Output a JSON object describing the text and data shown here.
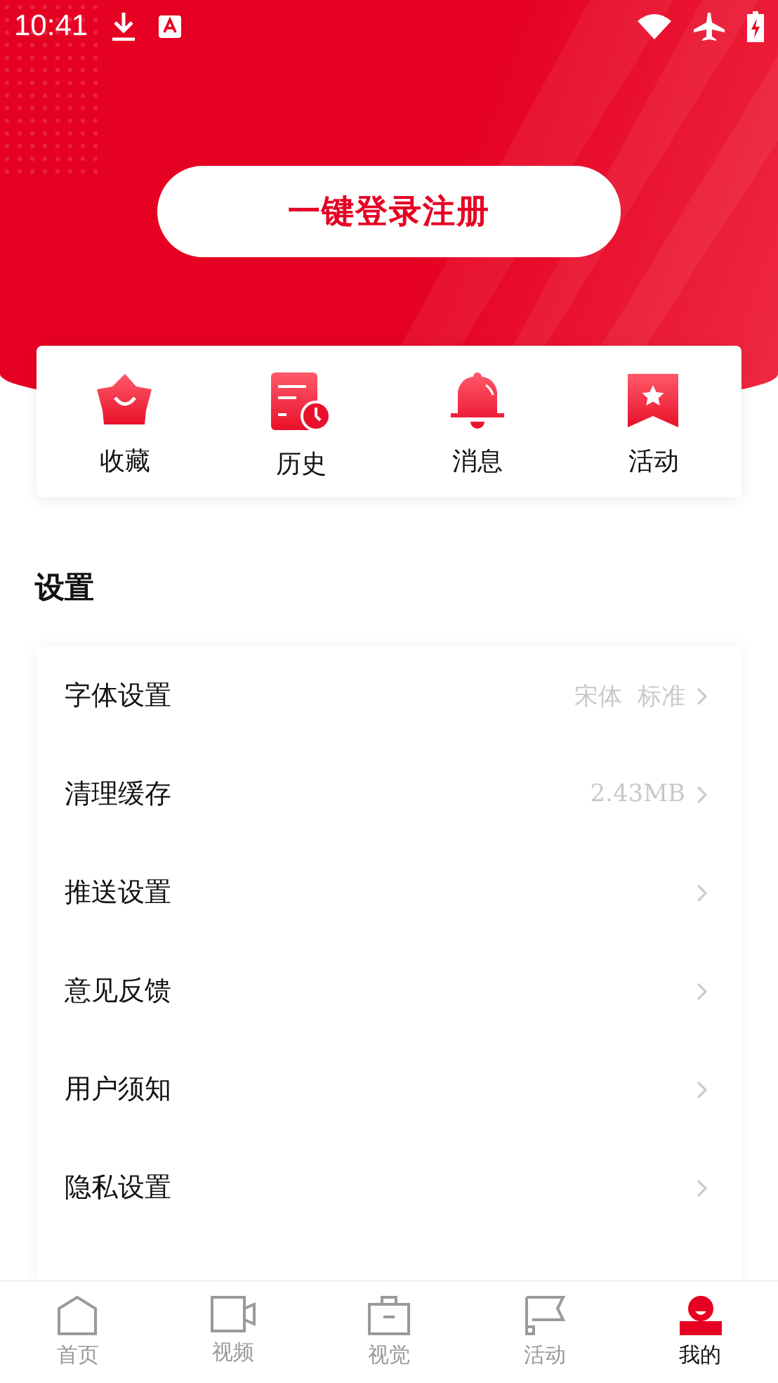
{
  "status_bar": {
    "time": "10:41"
  },
  "login_button": "一键登录注册",
  "shortcuts": [
    {
      "kind": "favorite",
      "label": "收藏"
    },
    {
      "kind": "history",
      "label": "历史"
    },
    {
      "kind": "message",
      "label": "消息"
    },
    {
      "kind": "activity",
      "label": "活动"
    }
  ],
  "settings": {
    "title": "设置",
    "items": [
      {
        "label": "字体设置",
        "value": "宋体  标准"
      },
      {
        "label": "清理缓存",
        "value": "2.43MB"
      },
      {
        "label": "推送设置"
      },
      {
        "label": "意见反馈"
      },
      {
        "label": "用户须知"
      },
      {
        "label": "隐私设置"
      }
    ]
  },
  "tab_bar": [
    {
      "kind": "home",
      "label": "首页",
      "selected": false
    },
    {
      "kind": "video",
      "label": "视频",
      "selected": false
    },
    {
      "kind": "visual",
      "label": "视觉",
      "selected": false
    },
    {
      "kind": "flag",
      "label": "活动",
      "selected": false
    },
    {
      "kind": "me",
      "label": "我的",
      "selected": true
    }
  ]
}
